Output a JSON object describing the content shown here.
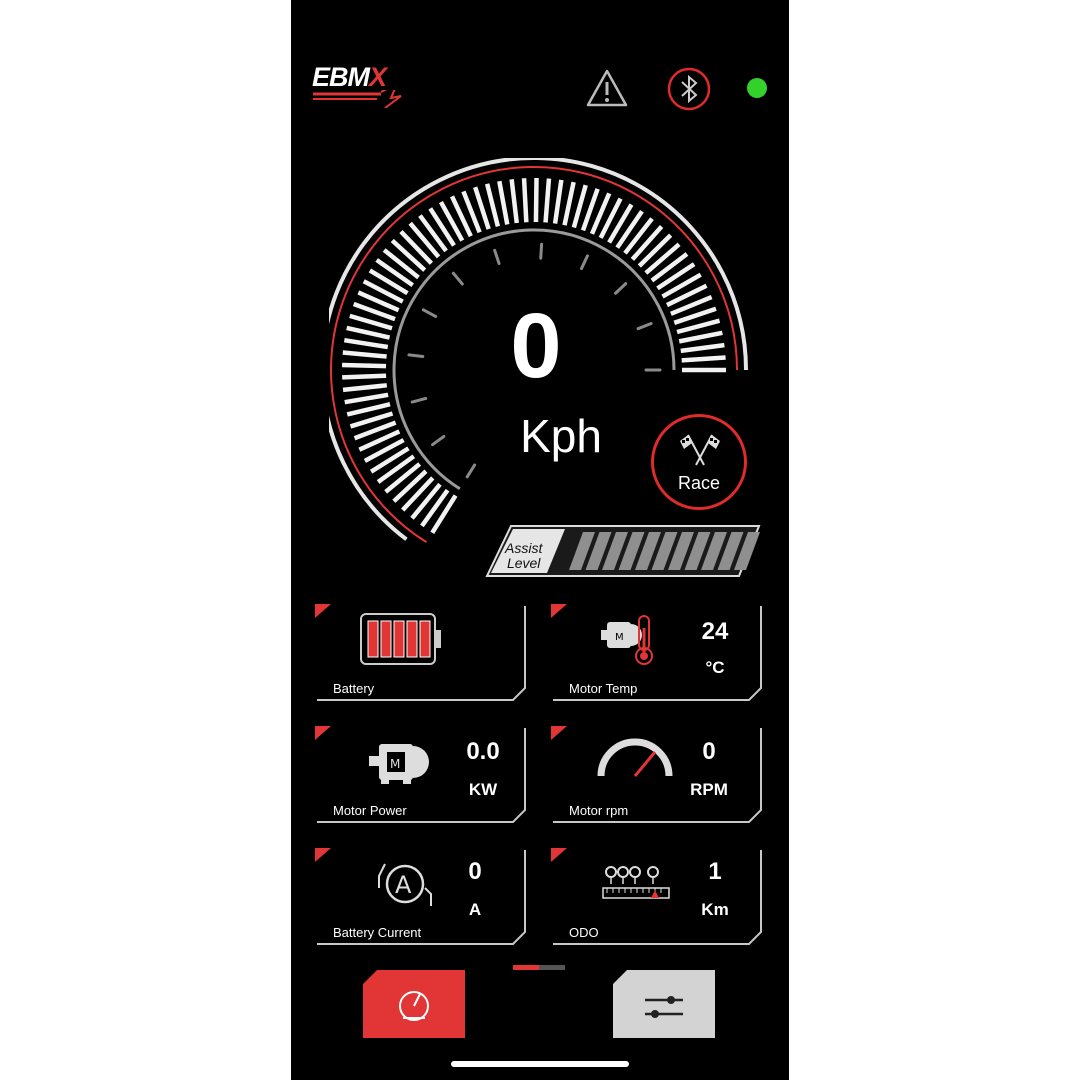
{
  "brand": {
    "logo_text": "EBM",
    "logo_accent": "X"
  },
  "status": {
    "warning_icon": "warning-triangle-icon",
    "bluetooth_icon": "bluetooth-icon",
    "connection_color": "#34d12b"
  },
  "speedometer": {
    "speed": "0",
    "unit": "Kph"
  },
  "race_button": {
    "label": "Race",
    "icon": "checkered-flags-icon"
  },
  "assist": {
    "label_line1": "Assist",
    "label_line2": "Level"
  },
  "tiles": {
    "battery": {
      "label": "Battery",
      "icon": "battery-icon"
    },
    "motor_temp": {
      "label": "Motor Temp",
      "value": "24",
      "unit": "°C",
      "icon": "motor-thermometer-icon"
    },
    "motor_power": {
      "label": "Motor Power",
      "value": "0.0",
      "unit": "KW",
      "icon": "motor-icon"
    },
    "motor_rpm": {
      "label": "Motor rpm",
      "value": "0",
      "unit": "RPM",
      "icon": "rpm-gauge-icon"
    },
    "battery_current": {
      "label": "Battery Current",
      "value": "0",
      "unit": "A",
      "icon": "ammeter-icon"
    },
    "odo": {
      "label": "ODO",
      "value": "1",
      "unit": "Km",
      "icon": "odometer-icon"
    }
  },
  "bottom_nav": {
    "left_icon": "dashboard-gauge-icon",
    "right_icon": "settings-sliders-icon"
  },
  "colors": {
    "accent": "#e23535",
    "background": "#000000",
    "tile_border": "#c8c8c8"
  }
}
